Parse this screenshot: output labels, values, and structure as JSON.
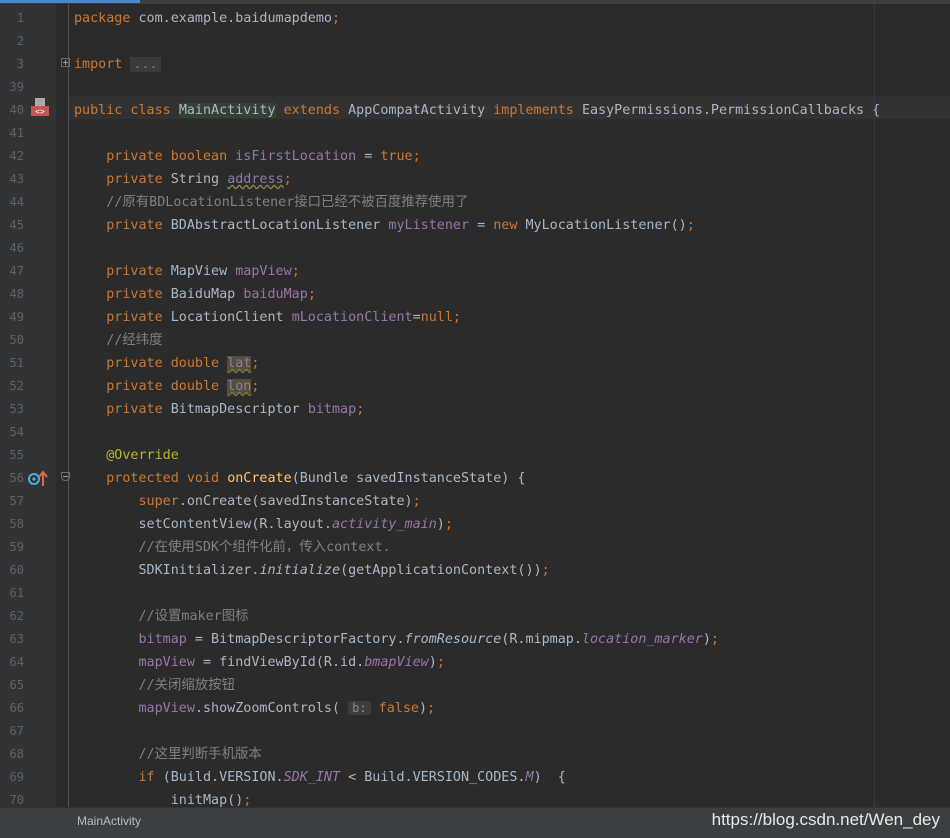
{
  "statusbar": {
    "file": "MainActivity"
  },
  "watermark": "https://blog.csdn.net/Wen_dey",
  "colors": {
    "background": "#2b2b2b",
    "gutter": "#313335",
    "keyword": "#cc7832",
    "field": "#9876aa",
    "method": "#ffc66d",
    "annotation": "#bbb529",
    "comment": "#808080",
    "plain": "#a9b7c6"
  },
  "gutter_icons": [
    "implementation-marker-icon",
    "override-method-icon"
  ],
  "lines": [
    {
      "n": "1",
      "segments": [
        {
          "t": "package ",
          "c": "kw"
        },
        {
          "t": "com.example.baidumapdemo"
        },
        {
          "t": ";",
          "c": "kw"
        }
      ]
    },
    {
      "n": "2",
      "segments": []
    },
    {
      "n": "3",
      "segments": [
        {
          "t": "import ",
          "c": "kw"
        },
        {
          "t": "...",
          "c": "fold-box"
        }
      ]
    },
    {
      "n": "39",
      "segments": []
    },
    {
      "n": "40",
      "segments": [
        {
          "t": "public class ",
          "c": "kw"
        },
        {
          "t": "MainActivity",
          "c": "cls-hl"
        },
        {
          "t": " extends ",
          "c": "kw"
        },
        {
          "t": "AppCompatActivity "
        },
        {
          "t": "implements ",
          "c": "kw"
        },
        {
          "t": "EasyPermissions.PermissionCallbacks {"
        }
      ]
    },
    {
      "n": "41",
      "segments": []
    },
    {
      "n": "42",
      "segments": [
        {
          "t": "    private boolean ",
          "c": "kw"
        },
        {
          "t": "isFirstLocation",
          "c": "fld"
        },
        {
          "t": " = "
        },
        {
          "t": "true;",
          "c": "kw"
        }
      ]
    },
    {
      "n": "43",
      "segments": [
        {
          "t": "    private ",
          "c": "kw"
        },
        {
          "t": "String "
        },
        {
          "t": "address",
          "c": "fld wavy"
        },
        {
          "t": ";",
          "c": "kw"
        }
      ]
    },
    {
      "n": "44",
      "segments": [
        {
          "t": "    //原有BDLocationListener接口已经不被百度推荐使用了",
          "c": "cmt"
        }
      ]
    },
    {
      "n": "45",
      "segments": [
        {
          "t": "    private ",
          "c": "kw"
        },
        {
          "t": "BDAbstractLocationListener "
        },
        {
          "t": "myListener",
          "c": "fld"
        },
        {
          "t": " = "
        },
        {
          "t": "new ",
          "c": "kw"
        },
        {
          "t": "MyLocationListener()"
        },
        {
          "t": ";",
          "c": "kw"
        }
      ]
    },
    {
      "n": "46",
      "segments": []
    },
    {
      "n": "47",
      "segments": [
        {
          "t": "    private ",
          "c": "kw"
        },
        {
          "t": "MapView "
        },
        {
          "t": "mapView",
          "c": "fld"
        },
        {
          "t": ";",
          "c": "kw"
        }
      ]
    },
    {
      "n": "48",
      "segments": [
        {
          "t": "    private ",
          "c": "kw"
        },
        {
          "t": "BaiduMap "
        },
        {
          "t": "baiduMap",
          "c": "fld"
        },
        {
          "t": ";",
          "c": "kw"
        }
      ]
    },
    {
      "n": "49",
      "segments": [
        {
          "t": "    private ",
          "c": "kw"
        },
        {
          "t": "LocationClient "
        },
        {
          "t": "mLocationClient",
          "c": "fld"
        },
        {
          "t": "="
        },
        {
          "t": "null;",
          "c": "kw"
        }
      ]
    },
    {
      "n": "50",
      "segments": [
        {
          "t": "    //经纬度",
          "c": "cmt"
        }
      ]
    },
    {
      "n": "51",
      "segments": [
        {
          "t": "    private double ",
          "c": "kw"
        },
        {
          "t": "lat",
          "c": "fld warn"
        },
        {
          "t": ";",
          "c": "kw"
        }
      ]
    },
    {
      "n": "52",
      "segments": [
        {
          "t": "    private double ",
          "c": "kw"
        },
        {
          "t": "lon",
          "c": "fld warn"
        },
        {
          "t": ";",
          "c": "kw"
        }
      ]
    },
    {
      "n": "53",
      "segments": [
        {
          "t": "    private ",
          "c": "kw"
        },
        {
          "t": "BitmapDescriptor "
        },
        {
          "t": "bitmap",
          "c": "fld"
        },
        {
          "t": ";",
          "c": "kw"
        }
      ]
    },
    {
      "n": "54",
      "segments": []
    },
    {
      "n": "55",
      "segments": [
        {
          "t": "    @Override",
          "c": "ann"
        }
      ]
    },
    {
      "n": "56",
      "segments": [
        {
          "t": "    protected void ",
          "c": "kw"
        },
        {
          "t": "onCreate",
          "c": "fn"
        },
        {
          "t": "(Bundle savedInstanceState) {"
        }
      ]
    },
    {
      "n": "57",
      "segments": [
        {
          "t": "        super",
          "c": "kw"
        },
        {
          "t": ".onCreate(savedInstanceState)"
        },
        {
          "t": ";",
          "c": "kw"
        }
      ]
    },
    {
      "n": "58",
      "segments": [
        {
          "t": "        setContentView(R.layout."
        },
        {
          "t": "activity_main",
          "c": "fld st"
        },
        {
          "t": ")"
        },
        {
          "t": ";",
          "c": "kw"
        }
      ]
    },
    {
      "n": "59",
      "segments": [
        {
          "t": "        //在使用SDK个组件化前，传入context.",
          "c": "cmt"
        }
      ]
    },
    {
      "n": "60",
      "segments": [
        {
          "t": "        SDKInitializer."
        },
        {
          "t": "initialize",
          "c": "st"
        },
        {
          "t": "(getApplicationContext())"
        },
        {
          "t": ";",
          "c": "kw"
        }
      ]
    },
    {
      "n": "61",
      "segments": []
    },
    {
      "n": "62",
      "segments": [
        {
          "t": "        //设置maker图标",
          "c": "cmt"
        }
      ]
    },
    {
      "n": "63",
      "segments": [
        {
          "t": "        "
        },
        {
          "t": "bitmap",
          "c": "fld"
        },
        {
          "t": " = BitmapDescriptorFactory."
        },
        {
          "t": "fromResource",
          "c": "st"
        },
        {
          "t": "(R.mipmap."
        },
        {
          "t": "location_marker",
          "c": "fld st"
        },
        {
          "t": ")"
        },
        {
          "t": ";",
          "c": "kw"
        }
      ]
    },
    {
      "n": "64",
      "segments": [
        {
          "t": "        "
        },
        {
          "t": "mapView",
          "c": "fld"
        },
        {
          "t": " = findViewById(R.id."
        },
        {
          "t": "bmapView",
          "c": "fld st"
        },
        {
          "t": ")"
        },
        {
          "t": ";",
          "c": "kw"
        }
      ]
    },
    {
      "n": "65",
      "segments": [
        {
          "t": "        //关闭缩放按钮",
          "c": "cmt"
        }
      ]
    },
    {
      "n": "66",
      "segments": [
        {
          "t": "        "
        },
        {
          "t": "mapView",
          "c": "fld"
        },
        {
          "t": ".showZoomControls( "
        },
        {
          "t": "b:",
          "c": "hint"
        },
        {
          "t": " false",
          "c": "kw"
        },
        {
          "t": ")"
        },
        {
          "t": ";",
          "c": "kw"
        }
      ]
    },
    {
      "n": "67",
      "segments": []
    },
    {
      "n": "68",
      "segments": [
        {
          "t": "        //这里判断手机版本",
          "c": "cmt"
        }
      ]
    },
    {
      "n": "69",
      "segments": [
        {
          "t": "        if ",
          "c": "kw"
        },
        {
          "t": "(Build.VERSION."
        },
        {
          "t": "SDK_INT",
          "c": "fld st"
        },
        {
          "t": " < Build.VERSION_CODES."
        },
        {
          "t": "M",
          "c": "fld st"
        },
        {
          "t": ")  {"
        }
      ]
    },
    {
      "n": "70",
      "segments": [
        {
          "t": "            initMap()"
        },
        {
          "t": ";",
          "c": "kw"
        }
      ]
    }
  ]
}
